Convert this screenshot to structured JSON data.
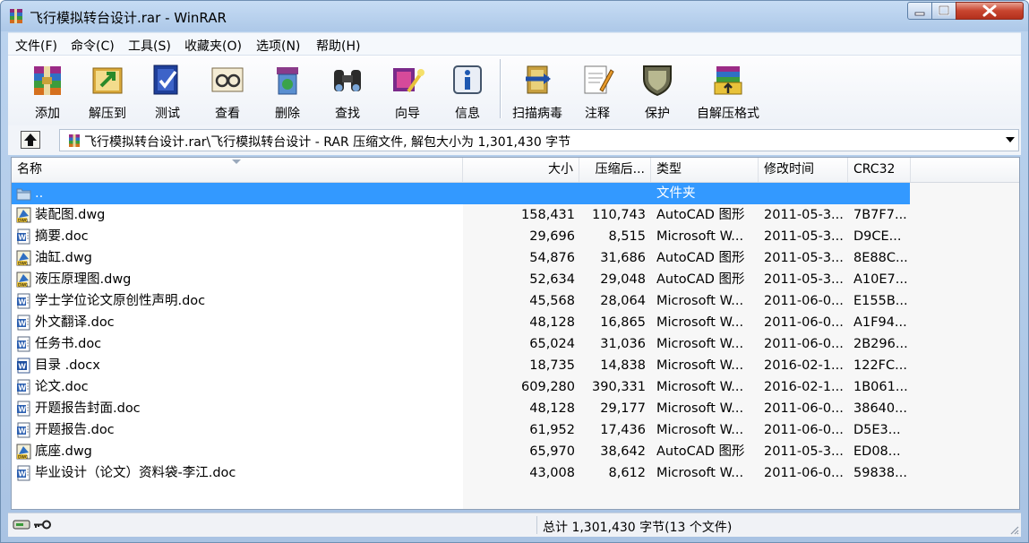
{
  "window": {
    "title": "飞行模拟转台设计.rar - WinRAR"
  },
  "menu": [
    {
      "label": "文件(F)"
    },
    {
      "label": "命令(C)"
    },
    {
      "label": "工具(S)"
    },
    {
      "label": "收藏夹(O)"
    },
    {
      "label": "选项(N)"
    },
    {
      "label": "帮助(H)"
    }
  ],
  "toolbar": [
    {
      "label": "添加",
      "icon": "add-archive-icon"
    },
    {
      "label": "解压到",
      "icon": "extract-icon"
    },
    {
      "label": "测试",
      "icon": "test-icon"
    },
    {
      "label": "查看",
      "icon": "view-icon"
    },
    {
      "label": "删除",
      "icon": "delete-icon"
    },
    {
      "label": "查找",
      "icon": "find-icon"
    },
    {
      "label": "向导",
      "icon": "wizard-icon"
    },
    {
      "label": "信息",
      "icon": "info-icon"
    },
    {
      "label": "扫描病毒",
      "icon": "virus-scan-icon"
    },
    {
      "label": "注释",
      "icon": "comment-icon"
    },
    {
      "label": "保护",
      "icon": "protect-icon"
    },
    {
      "label": "自解压格式",
      "icon": "sfx-icon"
    }
  ],
  "address": {
    "path": "飞行模拟转台设计.rar\\飞行模拟转台设计 - RAR 压缩文件, 解包大小为 1,301,430 字节"
  },
  "columns": {
    "name": "名称",
    "size": "大小",
    "packed": "压缩后...",
    "type": "类型",
    "modified": "修改时间",
    "crc": "CRC32"
  },
  "rows": [
    {
      "name": "..",
      "size": "",
      "packed": "",
      "type": "文件夹",
      "modified": "",
      "crc": "",
      "icon": "folder-icon",
      "selected": true
    },
    {
      "name": "装配图.dwg",
      "size": "158,431",
      "packed": "110,743",
      "type": "AutoCAD 图形",
      "modified": "2011-05-3...",
      "crc": "7B7F7...",
      "icon": "dwg-file-icon"
    },
    {
      "name": "摘要.doc",
      "size": "29,696",
      "packed": "8,515",
      "type": "Microsoft W...",
      "modified": "2011-05-3...",
      "crc": "D9CE...",
      "icon": "word-doc-icon"
    },
    {
      "name": "油缸.dwg",
      "size": "54,876",
      "packed": "31,686",
      "type": "AutoCAD 图形",
      "modified": "2011-05-3...",
      "crc": "8E88C...",
      "icon": "dwg-file-icon"
    },
    {
      "name": "液压原理图.dwg",
      "size": "52,634",
      "packed": "29,048",
      "type": "AutoCAD 图形",
      "modified": "2011-05-3...",
      "crc": "A10E7...",
      "icon": "dwg-file-icon"
    },
    {
      "name": "学士学位论文原创性声明.doc",
      "size": "45,568",
      "packed": "28,064",
      "type": "Microsoft W...",
      "modified": "2011-06-0...",
      "crc": "E155B...",
      "icon": "word-doc-icon"
    },
    {
      "name": "外文翻译.doc",
      "size": "48,128",
      "packed": "16,865",
      "type": "Microsoft W...",
      "modified": "2011-06-0...",
      "crc": "A1F94...",
      "icon": "word-doc-icon"
    },
    {
      "name": "任务书.doc",
      "size": "65,024",
      "packed": "31,036",
      "type": "Microsoft W...",
      "modified": "2011-06-0...",
      "crc": "2B296...",
      "icon": "word-doc-icon"
    },
    {
      "name": "目录 .docx",
      "size": "18,735",
      "packed": "14,838",
      "type": "Microsoft W...",
      "modified": "2016-02-1...",
      "crc": "122FC...",
      "icon": "word-docx-icon"
    },
    {
      "name": "论文.doc",
      "size": "609,280",
      "packed": "390,331",
      "type": "Microsoft W...",
      "modified": "2016-02-1...",
      "crc": "1B061...",
      "icon": "word-doc-icon"
    },
    {
      "name": "开题报告封面.doc",
      "size": "48,128",
      "packed": "29,177",
      "type": "Microsoft W...",
      "modified": "2011-06-0...",
      "crc": "38640...",
      "icon": "word-doc-icon"
    },
    {
      "name": "开题报告.doc",
      "size": "61,952",
      "packed": "17,436",
      "type": "Microsoft W...",
      "modified": "2011-06-0...",
      "crc": "D5E3...",
      "icon": "word-doc-icon"
    },
    {
      "name": "底座.dwg",
      "size": "65,970",
      "packed": "38,642",
      "type": "AutoCAD 图形",
      "modified": "2011-05-3...",
      "crc": "ED08...",
      "icon": "dwg-file-icon"
    },
    {
      "name": "毕业设计（论文）资料袋-李江.doc",
      "size": "43,008",
      "packed": "8,612",
      "type": "Microsoft W...",
      "modified": "2011-06-0...",
      "crc": "59838...",
      "icon": "word-doc-icon"
    }
  ],
  "status": {
    "summary": "总计 1,301,430 字节(13 个文件)"
  },
  "colors": {
    "selection": "#3399ff",
    "titlebar": "#b9d1ea",
    "close_button": "#c8452f"
  }
}
